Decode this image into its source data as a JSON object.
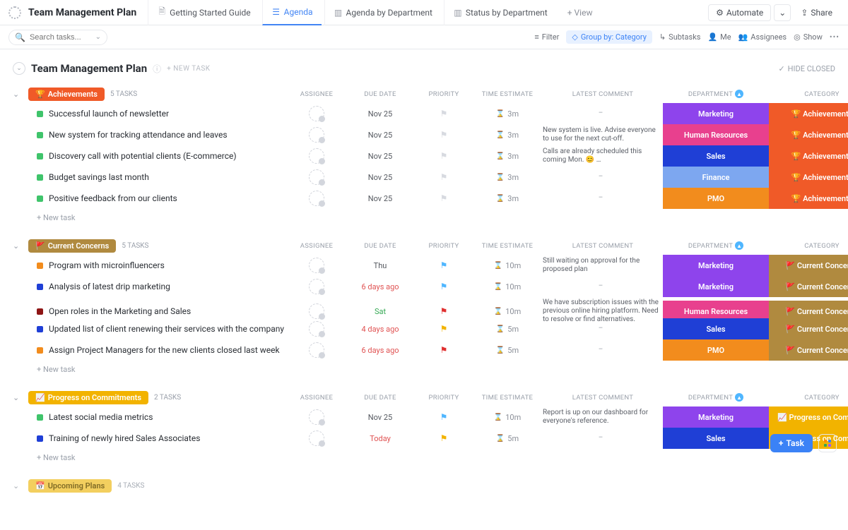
{
  "header": {
    "title": "Team Management Plan",
    "tabs": [
      {
        "label": "Getting Started Guide",
        "active": false
      },
      {
        "label": "Agenda",
        "active": true
      },
      {
        "label": "Agenda by Department",
        "active": false
      },
      {
        "label": "Status by Department",
        "active": false
      }
    ],
    "addView": "+ View",
    "automate": "Automate",
    "share": "Share"
  },
  "subbar": {
    "searchPlaceholder": "Search tasks...",
    "filter": "Filter",
    "groupBy": "Group by: Category",
    "subtasks": "Subtasks",
    "me": "Me",
    "assignees": "Assignees",
    "show": "Show"
  },
  "page": {
    "title": "Team Management Plan",
    "newTask": "+ NEW TASK",
    "hideClosed": "HIDE CLOSED"
  },
  "columns": {
    "assignee": "ASSIGNEE",
    "due": "DUE DATE",
    "priority": "PRIORITY",
    "estimate": "TIME ESTIMATE",
    "comment": "LATEST COMMENT",
    "department": "DEPARTMENT",
    "category": "CATEGORY"
  },
  "newTaskRow": "+ New task",
  "colors": {
    "marketing": "#8e44ec",
    "hr": "#e8408e",
    "sales": "#1f3fd6",
    "finance": "#7da7f0",
    "pmo": "#f28c1d",
    "achievements": "#f05a28",
    "concerns": "#b08a3f",
    "progress": "#f2b300",
    "upcoming": "#f2b300",
    "groupAch": "#f05a28",
    "groupCon": "#b08a3f",
    "groupProg": "#f2b300",
    "groupUp": "#f2c744"
  },
  "groups": [
    {
      "name": "Achievements",
      "chipColor": "#f05a28",
      "emoji": "🏆",
      "count": "5 TASKS",
      "rows": [
        {
          "sq": "#3fc46b",
          "title": "Successful launch of newsletter",
          "due": "Nov 25",
          "dueCls": "",
          "flag": "#d7dae0",
          "est": "3m",
          "comment": "",
          "dept": "Marketing",
          "deptColor": "#8e44ec",
          "cat": "🏆 Achievements",
          "catColor": "#f05a28"
        },
        {
          "sq": "#3fc46b",
          "title": "New system for tracking attendance and leaves",
          "due": "Nov 25",
          "dueCls": "",
          "flag": "#d7dae0",
          "est": "3m",
          "comment": "New system is live. Advise everyone to use for the next cut-off.",
          "dept": "Human Resources",
          "deptColor": "#e8408e",
          "cat": "🏆 Achievements",
          "catColor": "#f05a28"
        },
        {
          "sq": "#3fc46b",
          "title": "Discovery call with potential clients (E-commerce)",
          "due": "Nov 25",
          "dueCls": "",
          "flag": "#d7dae0",
          "est": "3m",
          "comment": "Calls are already scheduled this coming Mon. 😊 …",
          "dept": "Sales",
          "deptColor": "#1f3fd6",
          "cat": "🏆 Achievements",
          "catColor": "#f05a28"
        },
        {
          "sq": "#3fc46b",
          "title": "Budget savings last month",
          "due": "Nov 25",
          "dueCls": "",
          "flag": "#d7dae0",
          "est": "3m",
          "comment": "",
          "dept": "Finance",
          "deptColor": "#7da7f0",
          "cat": "🏆 Achievements",
          "catColor": "#f05a28"
        },
        {
          "sq": "#3fc46b",
          "title": "Positive feedback from our clients",
          "due": "Nov 25",
          "dueCls": "",
          "flag": "#d7dae0",
          "est": "3m",
          "comment": "",
          "dept": "PMO",
          "deptColor": "#f28c1d",
          "cat": "🏆 Achievements",
          "catColor": "#f05a28"
        }
      ]
    },
    {
      "name": "Current Concerns",
      "chipColor": "#b08a3f",
      "emoji": "🚩",
      "count": "5 TASKS",
      "rows": [
        {
          "sq": "#f28c1d",
          "title": "Program with microinfluencers",
          "due": "Thu",
          "dueCls": "",
          "flag": "#4fb6ff",
          "est": "10m",
          "comment": "Still waiting on approval for the proposed plan",
          "dept": "Marketing",
          "deptColor": "#8e44ec",
          "cat": "🚩 Current Concerns",
          "catColor": "#b08a3f"
        },
        {
          "sq": "#1f3fd6",
          "title": "Analysis of latest drip marketing",
          "due": "6 days ago",
          "dueCls": "red",
          "flag": "#4fb6ff",
          "est": "10m",
          "comment": "",
          "dept": "Marketing",
          "deptColor": "#8e44ec",
          "cat": "🚩 Current Concerns",
          "catColor": "#b08a3f"
        },
        {
          "sq": "#8e1515",
          "title": "Open roles in the Marketing and Sales",
          "due": "Sat",
          "dueCls": "green",
          "flag": "#e03030",
          "est": "10m",
          "comment": "We have subscription issues with the previous online hiring platform. Need to resolve or find alternatives.",
          "dept": "Human Resources",
          "deptColor": "#e8408e",
          "cat": "🚩 Current Concerns",
          "catColor": "#b08a3f"
        },
        {
          "sq": "#1f3fd6",
          "title": "Updated list of client renewing their services with the company",
          "due": "4 days ago",
          "dueCls": "red",
          "flag": "#f2b300",
          "est": "5m",
          "comment": "",
          "dept": "Sales",
          "deptColor": "#1f3fd6",
          "cat": "🚩 Current Concerns",
          "catColor": "#b08a3f"
        },
        {
          "sq": "#f28c1d",
          "title": "Assign Project Managers for the new clients closed last week",
          "due": "6 days ago",
          "dueCls": "red",
          "flag": "#e03030",
          "est": "5m",
          "comment": "",
          "dept": "PMO",
          "deptColor": "#f28c1d",
          "cat": "🚩 Current Concerns",
          "catColor": "#b08a3f"
        }
      ]
    },
    {
      "name": "Progress on Commitments",
      "chipColor": "#f2b300",
      "emoji": "📈",
      "count": "2 TASKS",
      "rows": [
        {
          "sq": "#3fc46b",
          "title": "Latest social media metrics",
          "due": "Nov 25",
          "dueCls": "",
          "flag": "#4fb6ff",
          "est": "10m",
          "comment": "Report is up on our dashboard for everyone's reference.",
          "dept": "Marketing",
          "deptColor": "#8e44ec",
          "cat": "📈 Progress on Commit…",
          "catColor": "#f2b300"
        },
        {
          "sq": "#1f3fd6",
          "title": "Training of newly hired Sales Associates",
          "due": "Today",
          "dueCls": "red",
          "flag": "#f2b300",
          "est": "5m",
          "comment": "",
          "dept": "Sales",
          "deptColor": "#1f3fd6",
          "cat": "📈 Progress on Commit…",
          "catColor": "#f2b300"
        }
      ]
    }
  ],
  "upcoming": {
    "name": "Upcoming Plans",
    "count": "4 TASKS",
    "chipColor": "#f2c744",
    "emoji": "📅"
  },
  "fab": {
    "task": "Task"
  }
}
